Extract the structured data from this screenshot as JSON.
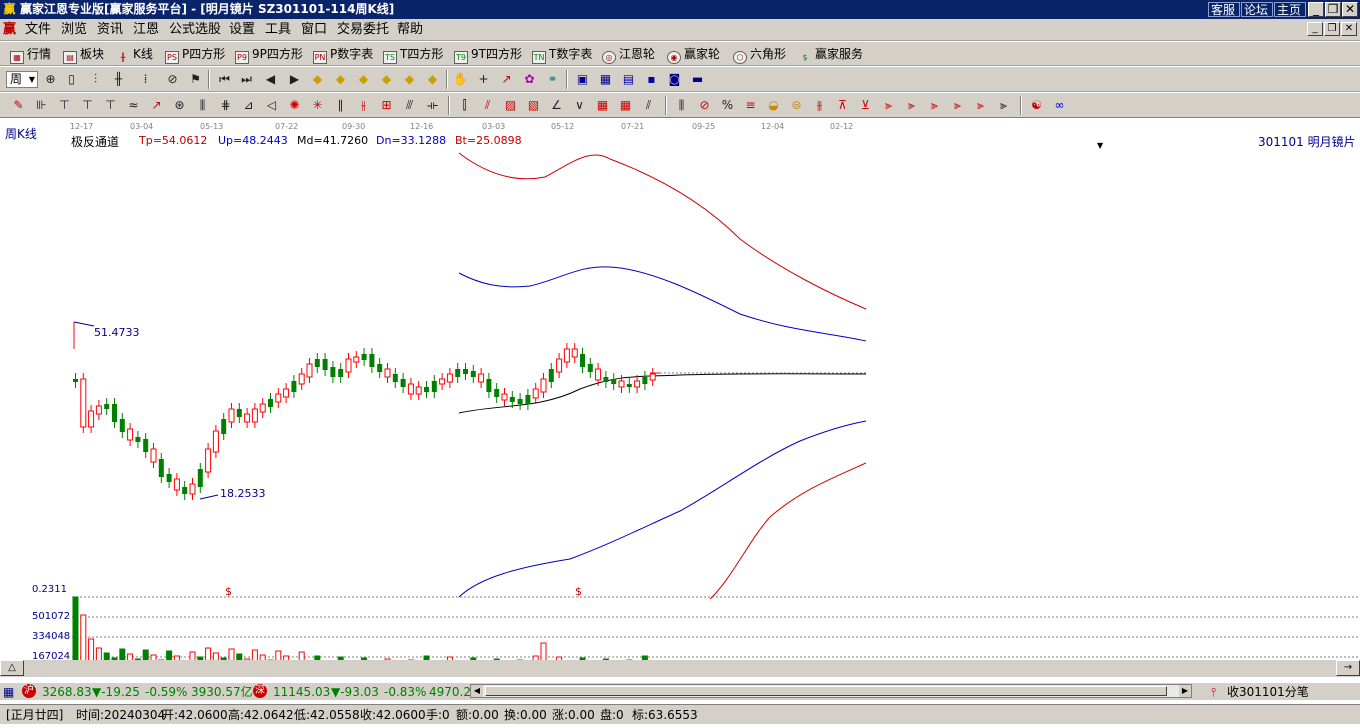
{
  "window": {
    "title": "赢家江恩专业版[赢家服务平台] - [明月镜片   SZ301101-114周K线]",
    "top_links": [
      "客服",
      "论坛",
      "主页"
    ]
  },
  "menu": {
    "items": [
      "文件",
      "浏览",
      "资讯",
      "江恩",
      "公式选股",
      "设置",
      "工具",
      "窗口",
      "交易委托",
      "帮助"
    ]
  },
  "toolbar1": {
    "items": [
      {
        "label": "行情",
        "icon": "grid-table-icon"
      },
      {
        "label": "板块",
        "icon": "blocks-icon"
      },
      {
        "label": "K线",
        "icon": "candlestick-icon"
      },
      {
        "label": "P四方形",
        "icon": "ps-icon"
      },
      {
        "label": "9P四方形",
        "icon": "p9-icon"
      },
      {
        "label": "P数字表",
        "icon": "pn-icon"
      },
      {
        "label": "T四方形",
        "icon": "ts-icon"
      },
      {
        "label": "9T四方形",
        "icon": "t9-icon"
      },
      {
        "label": "T数字表",
        "icon": "tn-icon"
      },
      {
        "label": "江恩轮",
        "icon": "wheel-icon"
      },
      {
        "label": "赢家轮",
        "icon": "winner-wheel-icon"
      },
      {
        "label": "六角形",
        "icon": "hexagon-icon"
      },
      {
        "label": "赢家服务",
        "icon": "dollar-icon"
      }
    ]
  },
  "toolbar2": {
    "period_label": "周"
  },
  "chart": {
    "period_label": "周K线",
    "date_ticks": [
      "12-17",
      "03-04",
      "05-13",
      "07-22",
      "09-30",
      "12-16",
      "03-03",
      "05-12",
      "07-21",
      "09-25",
      "12-04",
      "02-12"
    ],
    "indicator": {
      "name": "极反通道",
      "tp": "Tp=54.0612",
      "up": "Up=48.2443",
      "md": "Md=41.7260",
      "dn": "Dn=33.1288",
      "bt": "Bt=25.0898"
    },
    "stock_label": "301101  明月镜片",
    "high_label": "51.4733",
    "low_label": "18.2533",
    "volume_top_label": "0.2311",
    "volume_ticks": [
      "501072",
      "334048",
      "167024"
    ],
    "dollar_marker": "$",
    "colors": {
      "up": "#ff0000",
      "down": "#008000",
      "tp_bt": "#d00000",
      "up_dn": "#0000c0",
      "md": "#000000",
      "label_blue": "#00008b",
      "label_red": "#c00000"
    }
  },
  "status": {
    "sh_index": "3268.83",
    "sh_change": "▼-19.25",
    "sh_pct": "-0.59%",
    "sh_amount": "3930.57亿",
    "sz_index": "11145.03",
    "sz_change": "▼-93.03",
    "sz_pct": "-0.83%",
    "sz_amount": "4970.2",
    "tick_label": "收301101分笔"
  },
  "bar_info": {
    "lunar": "[正月廿四]",
    "time": "时间:20240304",
    "open": "开:42.0600",
    "high": "高:42.0642",
    "low": "低:42.0558",
    "close": "收:42.0600",
    "hand": "手:0",
    "amount": "额:0.00",
    "turnover": "换:0.00",
    "rise": "涨:0.00",
    "pan": "盘:0",
    "mark": "标:63.6553"
  }
}
